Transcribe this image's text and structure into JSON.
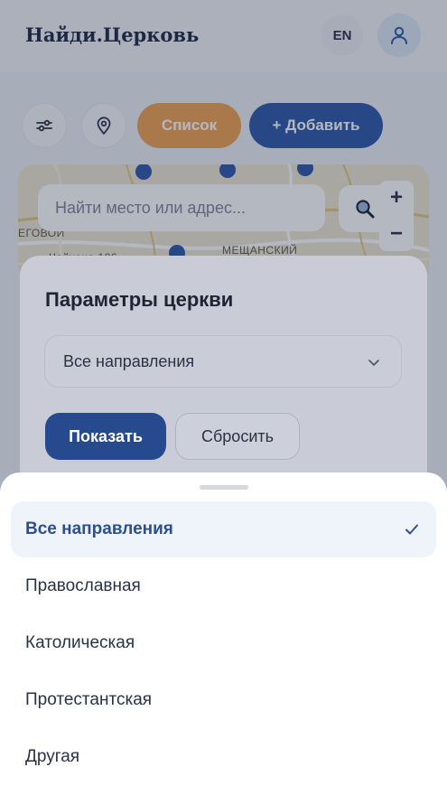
{
  "header": {
    "brand": "Найди.Церковь",
    "lang_label": "EN"
  },
  "toolbar": {
    "list_label": "Список",
    "add_label": "+ Добавить"
  },
  "map": {
    "search_placeholder": "Найти место или адрес...",
    "zoom_in": "+",
    "zoom_out": "−",
    "labels": [
      "ЕГОВОЙ",
      "МЕЩАНСКИЙ",
      "Чайхона 196"
    ]
  },
  "filter_panel": {
    "title": "Параметры церкви",
    "selected_value": "Все направления",
    "show_label": "Показать",
    "reset_label": "Сбросить"
  },
  "sheet": {
    "options": [
      {
        "label": "Все направления",
        "selected": true
      },
      {
        "label": "Православная",
        "selected": false
      },
      {
        "label": "Католическая",
        "selected": false
      },
      {
        "label": "Протестантская",
        "selected": false
      },
      {
        "label": "Другая",
        "selected": false
      }
    ]
  },
  "colors": {
    "accent_blue": "#2d57a8",
    "accent_orange": "#f0a24f",
    "selected_text": "#2c4f8f"
  }
}
